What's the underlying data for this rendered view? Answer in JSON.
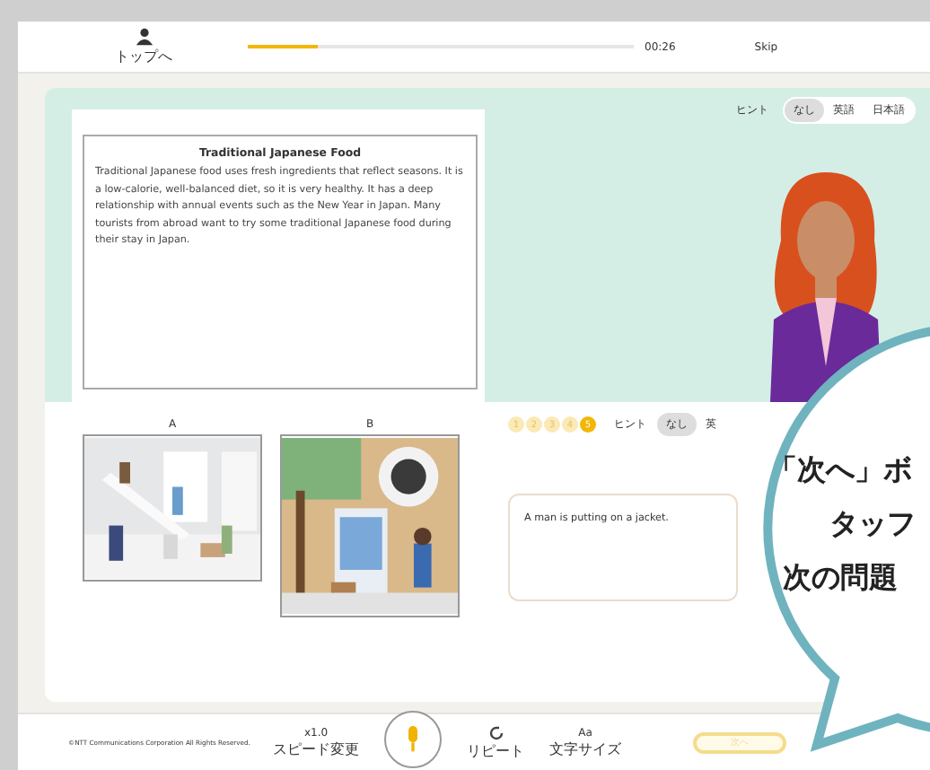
{
  "header": {
    "home_label": "トップへ",
    "progress": {
      "level": 0.18
    },
    "timer": "00:26",
    "skip": "Skip"
  },
  "passage": {
    "title": "Traditional Japanese Food",
    "body": "Traditional Japanese food uses fresh ingredients that reflect seasons. It is a low-calorie, well-balanced diet, so it is very healthy. It has a deep relationship with annual events such as the New Year in Japan. Many tourists from abroad want to try some traditional Japanese food during their stay in Japan."
  },
  "pictures": [
    {
      "label": "A",
      "kind": "picture"
    },
    {
      "label": "B",
      "kind": "picture"
    }
  ],
  "top_hint": {
    "label": "ヒント",
    "options": [
      {
        "label": "なし",
        "selected": true
      },
      {
        "label": "英語",
        "selected": false
      },
      {
        "label": "日本語",
        "selected": false
      }
    ]
  },
  "steps": [
    {
      "label": "1",
      "current": false
    },
    {
      "label": "2",
      "current": false
    },
    {
      "label": "3",
      "current": false
    },
    {
      "label": "4",
      "current": false
    },
    {
      "label": "5",
      "current": true
    }
  ],
  "answer_hint": {
    "label": "ヒント",
    "options": [
      {
        "label": "なし",
        "selected": true
      },
      {
        "label": "英",
        "selected": false
      }
    ]
  },
  "answer": "A man is putting on a jacket.",
  "footer": {
    "copyright": "©NTT Communications Corporation All Rights Reserved.",
    "speed": "x1.0",
    "speed_label": "スピード変更",
    "repeat_label": "リピート",
    "font_icon": "Aa",
    "font_label": "文字サイズ",
    "next": "次へ"
  },
  "callout": {
    "lines": [
      "「次へ」ボ",
      "タッフ",
      "次の問題"
    ]
  }
}
